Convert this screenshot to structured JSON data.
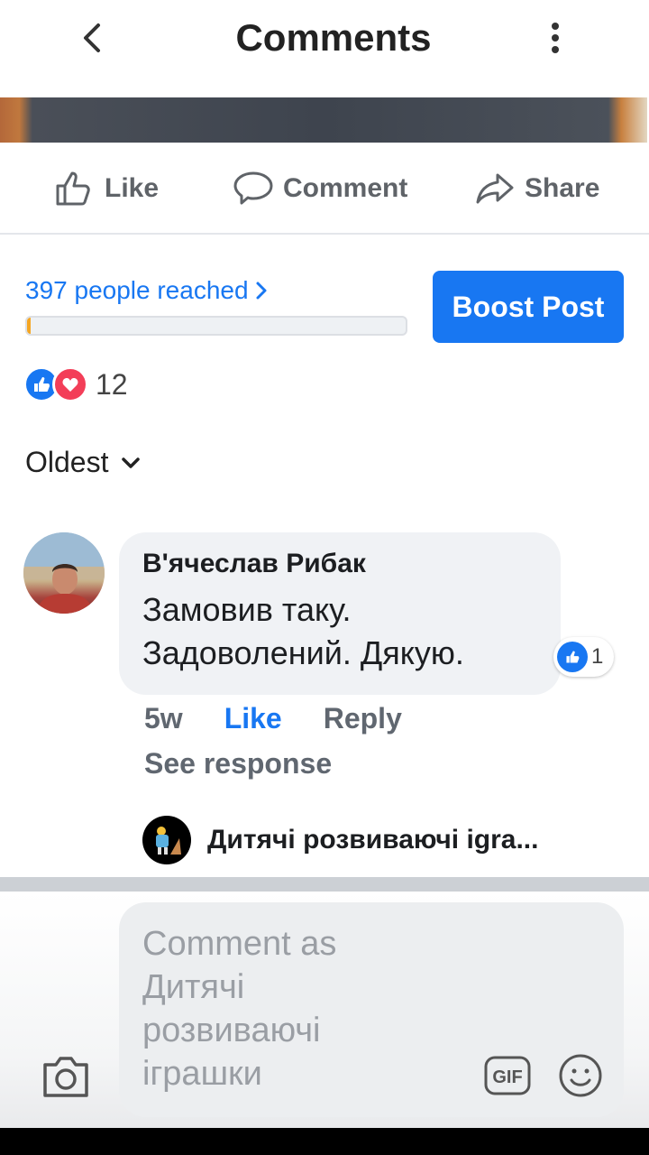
{
  "header": {
    "title": "Comments",
    "back_icon": "chevron-left-icon",
    "more_icon": "more-vertical-icon"
  },
  "actions": {
    "like_label": "Like",
    "comment_label": "Comment",
    "share_label": "Share"
  },
  "insights": {
    "reach_text": "397 people reached",
    "reach_progress": 0.01,
    "boost_label": "Boost Post"
  },
  "reactions": {
    "types": [
      "like",
      "love"
    ],
    "count": "12"
  },
  "sort": {
    "selected": "Oldest"
  },
  "comment": {
    "author": "В'ячеслав Рибак",
    "text": "Замовив таку. Задоволений. Дякую.",
    "reaction_count": "1",
    "time": "5w",
    "like_label": "Like",
    "reply_label": "Reply",
    "see_response": "See response",
    "reply_preview_name": "Дитячі розвиваючі igra..."
  },
  "composer": {
    "placeholder": "Comment as Дитячі розвиваючі іграшки",
    "gif_label": "GIF"
  },
  "colors": {
    "accent": "#1877f2",
    "love": "#f33e58",
    "progress": "#f5a623"
  }
}
